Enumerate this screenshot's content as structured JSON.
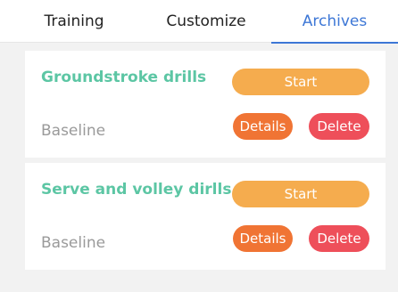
{
  "tabs": [
    {
      "label": "Training"
    },
    {
      "label": "Customize"
    },
    {
      "label": "Archives",
      "active": true
    }
  ],
  "colors": {
    "active_tab": "#3d77d6",
    "card_title": "#5cc6a4",
    "start_button": "#f5ac4e",
    "details_button": "#f07434",
    "delete_button": "#ee4f5a",
    "background": "#f2f2f2"
  },
  "cards": [
    {
      "title": "Groundstroke drills",
      "subtitle": "Baseline",
      "start_label": "Start",
      "details_label": "Details",
      "delete_label": "Delete"
    },
    {
      "title": "Serve and volley dirlls",
      "subtitle": "Baseline",
      "start_label": "Start",
      "details_label": "Details",
      "delete_label": "Delete"
    }
  ]
}
